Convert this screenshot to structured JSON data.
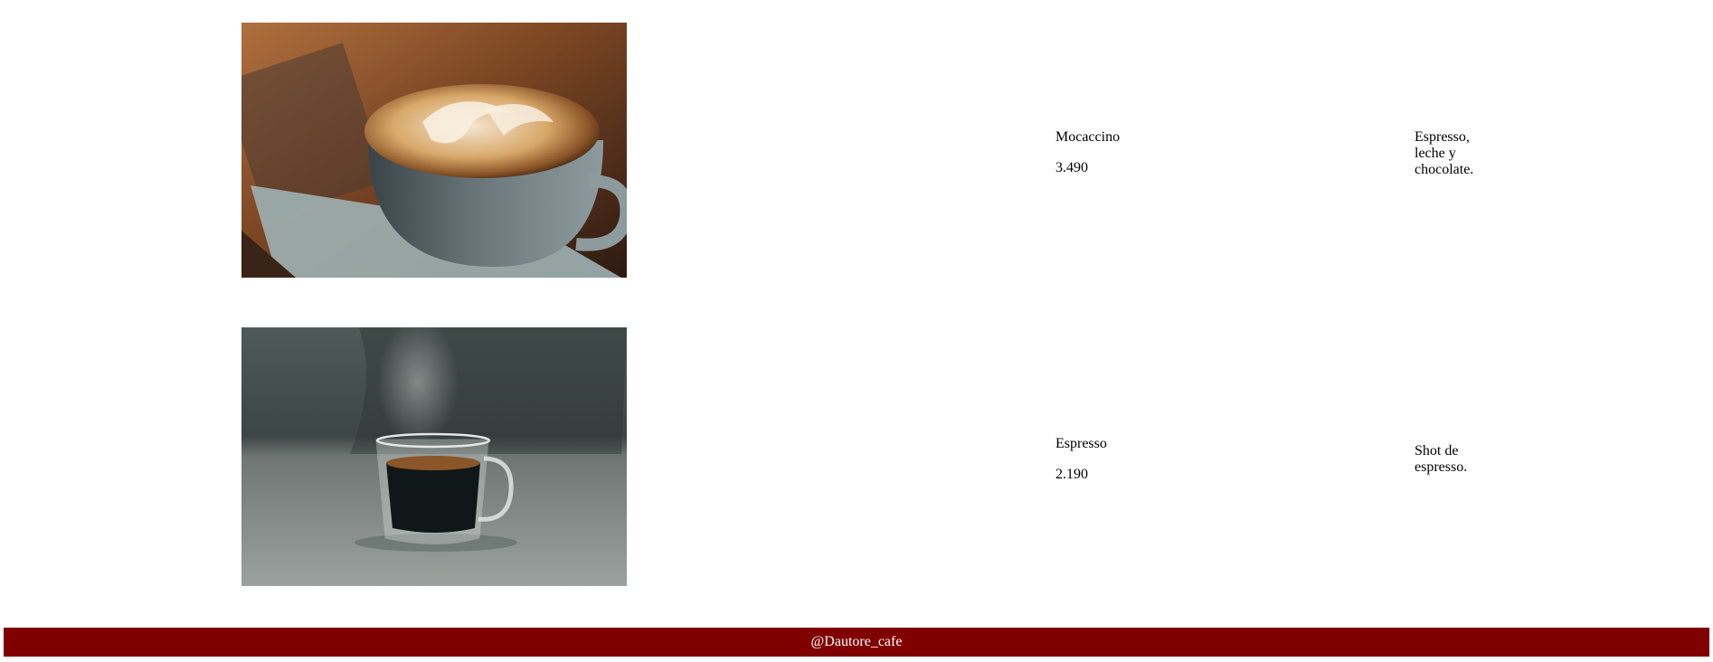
{
  "products": [
    {
      "name": "Mocaccino",
      "price": "3.490",
      "description": "Espresso, leche y chocolate.",
      "image_icon": "latte-art-cup-photo"
    },
    {
      "name": "Espresso",
      "price": "2.190",
      "description": "Shot de espresso.",
      "image_icon": "espresso-glass-cup-photo"
    }
  ],
  "footer": {
    "text": "@Dautore_cafe"
  },
  "colors": {
    "footer_bg": "#800000",
    "footer_text": "#ffffff",
    "background": "#ffffff"
  }
}
